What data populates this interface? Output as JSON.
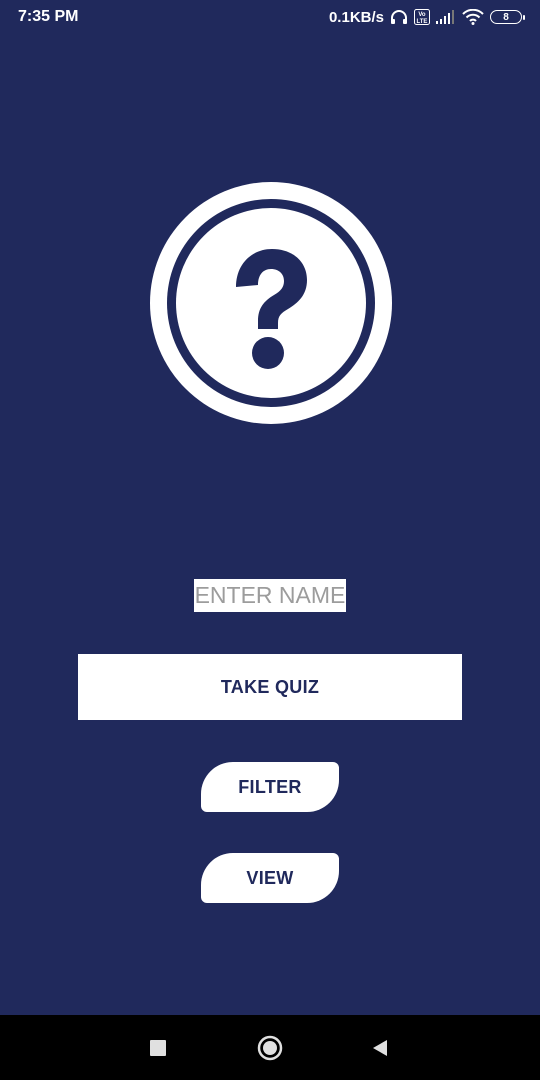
{
  "status_bar": {
    "time": "7:35 PM",
    "network_speed": "0.1KB/s",
    "battery_level": "8",
    "icons": [
      "headphones-icon",
      "volte-icon",
      "signal-icon",
      "wifi-icon",
      "battery-icon"
    ]
  },
  "logo": {
    "icon": "question-mark-icon",
    "colors": {
      "background": "#20295c",
      "foreground": "#ffffff"
    }
  },
  "form": {
    "name_placeholder": "ENTER NAME",
    "name_value": ""
  },
  "buttons": {
    "take_quiz": "TAKE QUIZ",
    "filter": "FILTER",
    "view": "VIEW"
  },
  "nav_bar": {
    "icons": [
      "recent-apps-icon",
      "home-icon",
      "back-icon"
    ]
  },
  "colors": {
    "primary": "#20295c",
    "surface": "#ffffff",
    "placeholder": "#9c9c9c"
  }
}
